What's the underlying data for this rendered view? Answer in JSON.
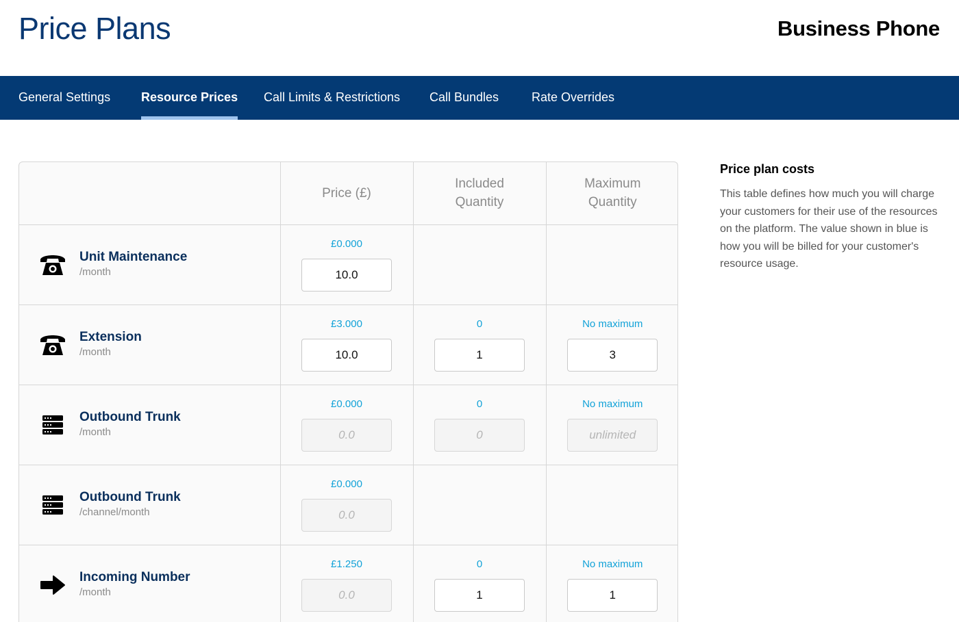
{
  "header": {
    "title": "Price Plans",
    "product": "Business Phone"
  },
  "tabs": [
    {
      "label": "General Settings",
      "active": false
    },
    {
      "label": "Resource Prices",
      "active": true
    },
    {
      "label": "Call Limits & Restrictions",
      "active": false
    },
    {
      "label": "Call Bundles",
      "active": false
    },
    {
      "label": "Rate Overrides",
      "active": false
    }
  ],
  "table": {
    "columns": {
      "price": "Price (£)",
      "included_line1": "Included",
      "included_line2": "Quantity",
      "maximum_line1": "Maximum",
      "maximum_line2": "Quantity"
    },
    "rows": [
      {
        "name": "Unit Maintenance",
        "unit": "/month",
        "icon": "telephone-icon",
        "price_billed": "£0.000",
        "price_value": "10.0",
        "price_placeholder": ""
      },
      {
        "name": "Extension",
        "unit": "/month",
        "icon": "telephone-icon",
        "price_billed": "£3.000",
        "price_value": "10.0",
        "price_placeholder": "",
        "included_billed": "0",
        "included_value": "1",
        "included_placeholder": "",
        "max_billed": "No maximum",
        "max_value": "3",
        "max_placeholder": ""
      },
      {
        "name": "Outbound Trunk",
        "unit": "/month",
        "icon": "server-icon",
        "price_billed": "£0.000",
        "price_value": "",
        "price_placeholder": "0.0",
        "included_billed": "0",
        "included_value": "",
        "included_placeholder": "0",
        "max_billed": "No maximum",
        "max_value": "",
        "max_placeholder": "unlimited"
      },
      {
        "name": "Outbound Trunk",
        "unit": "/channel/month",
        "icon": "server-icon",
        "price_billed": "£0.000",
        "price_value": "",
        "price_placeholder": "0.0"
      },
      {
        "name": "Incoming Number",
        "unit": "/month",
        "icon": "arrow-right-icon",
        "price_billed": "£1.250",
        "price_value": "",
        "price_placeholder": "0.0",
        "included_billed": "0",
        "included_value": "1",
        "included_placeholder": "",
        "max_billed": "No maximum",
        "max_value": "1",
        "max_placeholder": ""
      }
    ]
  },
  "sidebar": {
    "title": "Price plan costs",
    "text": "This table defines how much you will charge your customers for their use of the resources on the platform. The value shown in blue is how you will be billed for your customer's resource usage."
  },
  "colors": {
    "nav_bg": "#043a74",
    "title": "#0a3872",
    "billed_blue": "#12a2d8",
    "active_underline": "#9ec3ee"
  }
}
